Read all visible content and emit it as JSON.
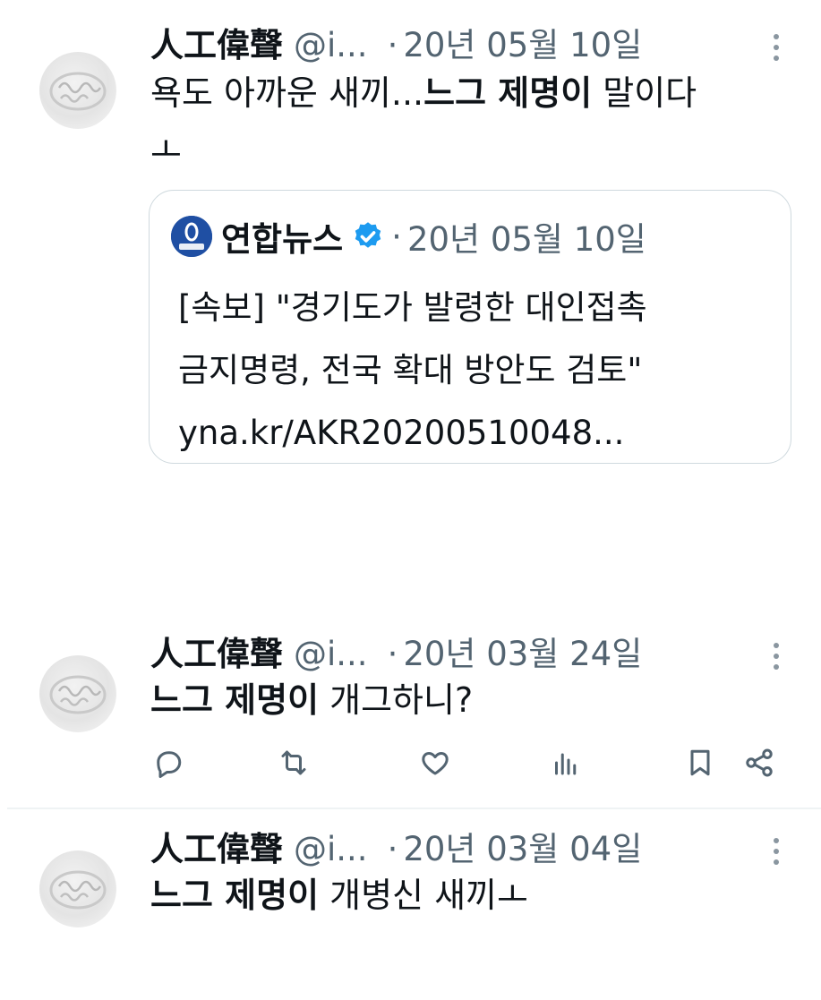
{
  "tweets": [
    {
      "name": "人工偉聲",
      "handle": "@i...",
      "dot": "·",
      "date": "20년 05월 10일",
      "line1_pre": "욕도 아까운 새끼...",
      "line1_bold": "느그 제명이",
      "line1_post": " 말이다",
      "line2": "ㅗ",
      "quote": {
        "logo_text": "연합뉴스",
        "name": "연합뉴스",
        "dot": "·",
        "date": "20년 05월 10일",
        "line1": "[속보] \"경기도가 발령한 대인접촉",
        "line2": "금지명령, 전국 확대 방안도 검토\"",
        "line3": "yna.kr/AKR20200510048..."
      }
    },
    {
      "name": "人工偉聲",
      "handle": "@i...",
      "dot": "·",
      "date": "20년 03월 24일",
      "text_bold": "느그 제명이",
      "text_post": " 개그하니?"
    },
    {
      "name": "人工偉聲",
      "handle": "@i...",
      "dot": "·",
      "date": "20년 03월 04일",
      "text_bold": "느그 제명이",
      "text_post": " 개병신 새끼ㅗ"
    }
  ],
  "icons": {
    "reply": "reply-icon",
    "retweet": "retweet-icon",
    "like": "like-icon",
    "views": "views-icon",
    "bookmark": "bookmark-icon",
    "share": "share-icon",
    "more": "more-icon",
    "verified": "verified-badge-icon"
  },
  "colors": {
    "text": "#0f1419",
    "secondary": "#536471",
    "verified": "#1d9bf0",
    "border": "#cfd9de"
  }
}
